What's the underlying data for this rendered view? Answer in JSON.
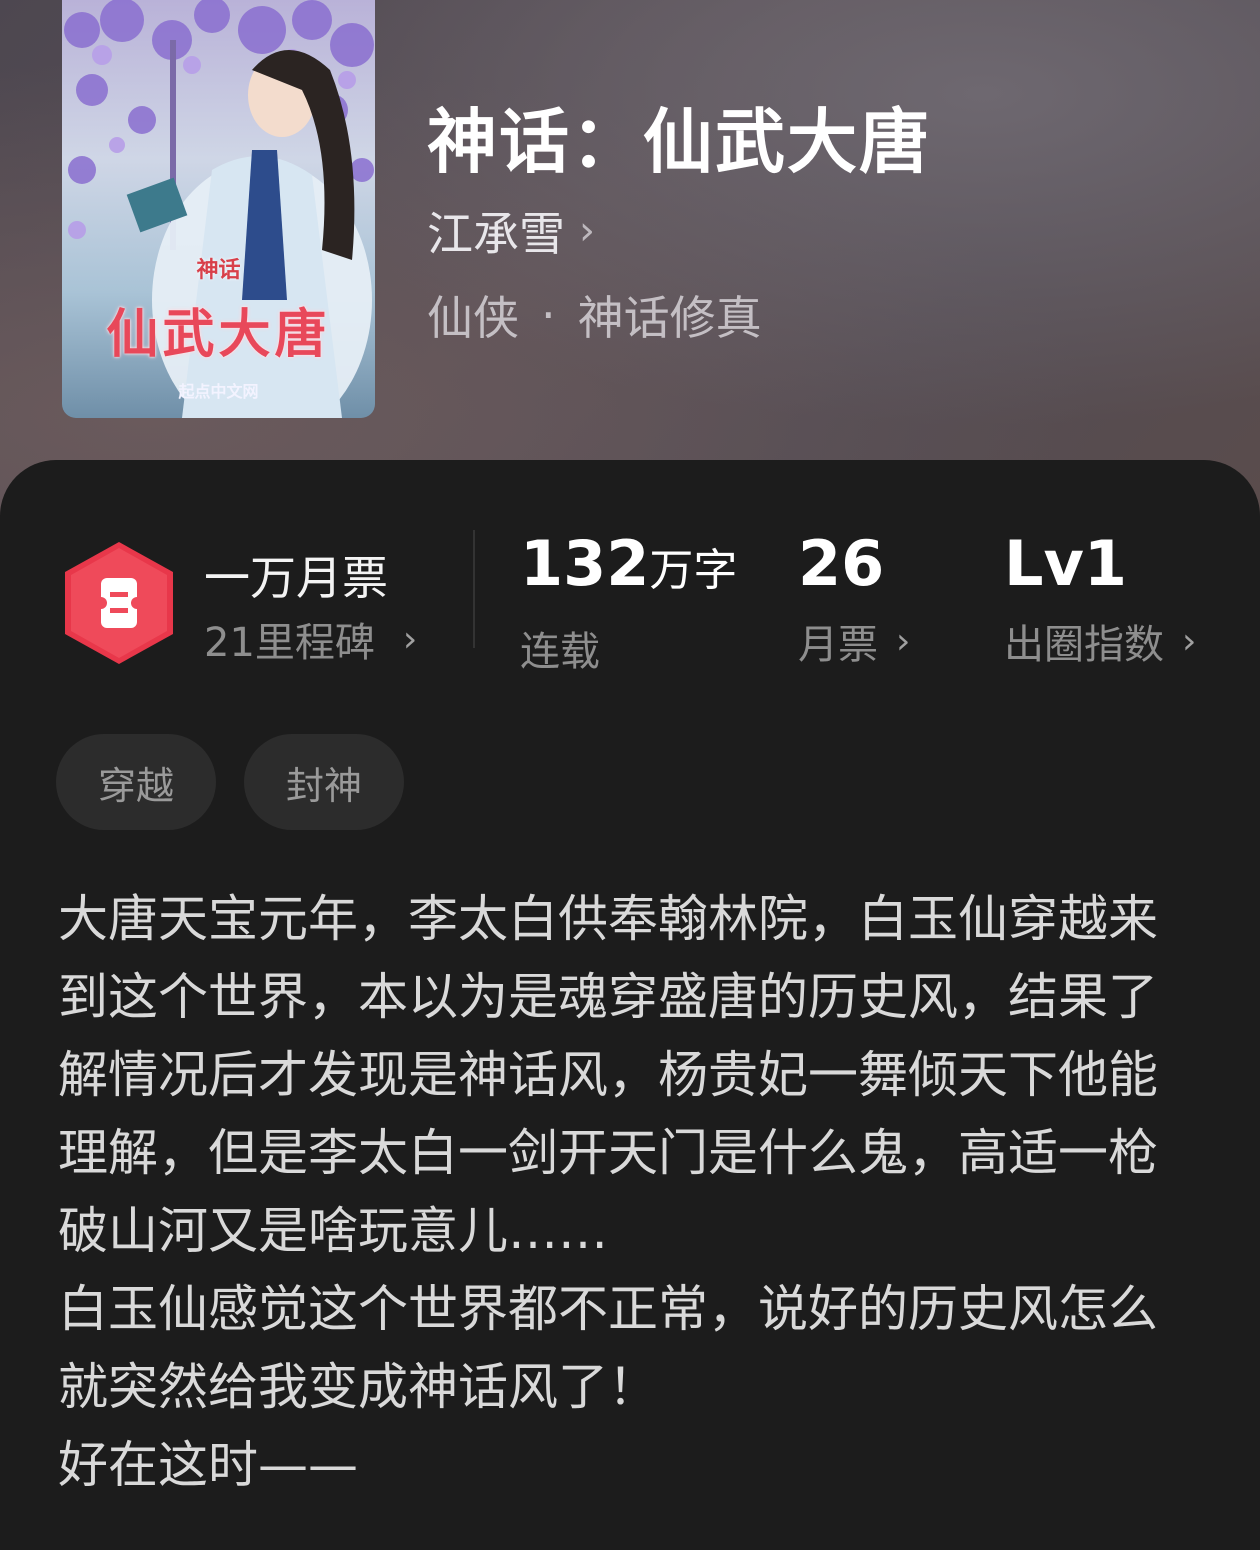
{
  "book": {
    "title": "神话：仙武大唐",
    "author": "江承雪",
    "category": "仙侠",
    "subcategory": "神话修真",
    "cover": {
      "small_title": "神话",
      "big_title": "仙武大唐",
      "publisher": "起点中文网"
    }
  },
  "milestone": {
    "title": "一万月票",
    "subtitle": "21里程碑",
    "badge_color": "#e8374a"
  },
  "stats": {
    "word_count": "132",
    "word_unit": "万字",
    "status": "连载",
    "monthly_votes": "26",
    "monthly_votes_label": "月票",
    "circle_index": "Lv1",
    "circle_index_label": "出圈指数"
  },
  "tags": [
    "穿越",
    "封神"
  ],
  "description": "大唐天宝元年，李太白供奉翰林院，白玉仙穿越来到这个世界，本以为是魂穿盛唐的历史风，结果了解情况后才发现是神话风，杨贵妃一舞倾天下他能理解，但是李太白一剑开天门是什么鬼，高适一枪破山河又是啥玩意儿……\n白玉仙感觉这个世界都不正常，说好的历史风怎么就突然给我变成神话风了！\n好在这时——"
}
